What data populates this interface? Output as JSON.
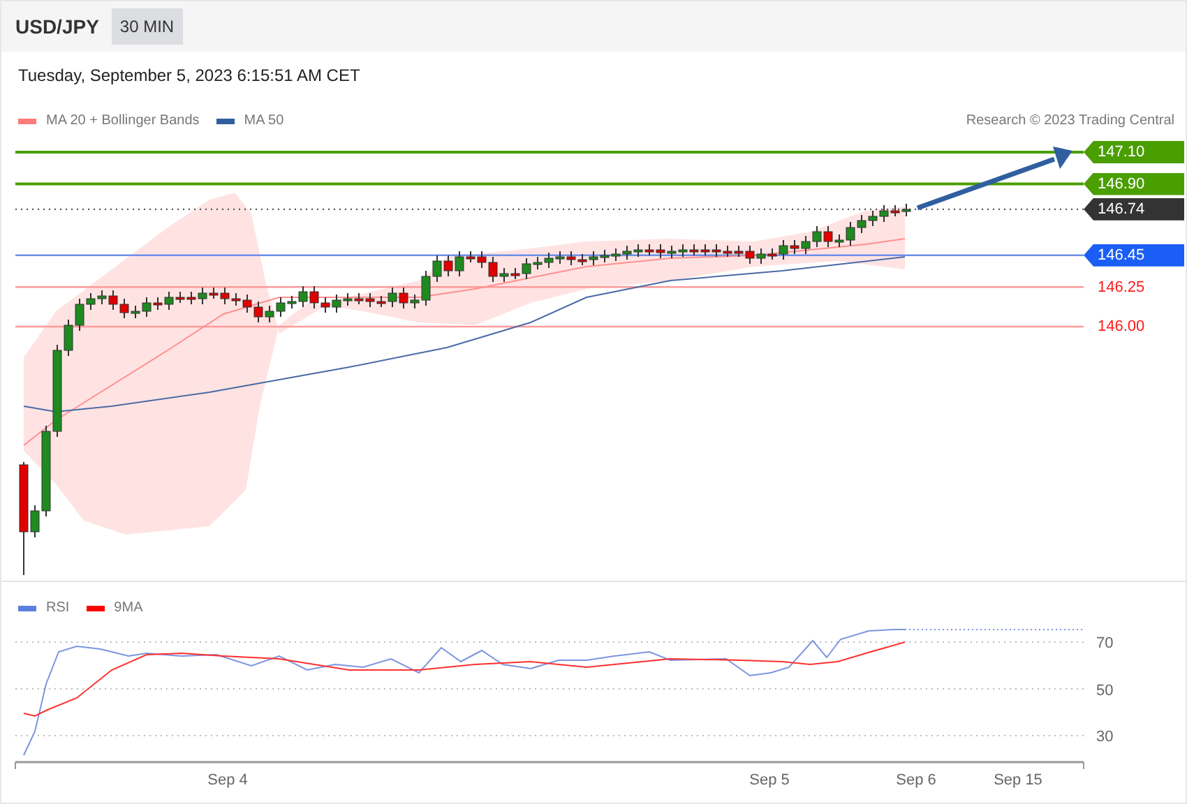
{
  "header": {
    "symbol": "USD/JPY",
    "interval": "30 MIN"
  },
  "timestamp": "Tuesday, September 5, 2023 6:15:51 AM CET",
  "legend": [
    {
      "label": "MA 20 + Bollinger Bands",
      "color": "#ff7b7b"
    },
    {
      "label": "MA 50",
      "color": "#2f5f9f"
    }
  ],
  "copyright": "Research © 2023 Trading Central",
  "levels": [
    {
      "value": "147.10",
      "kind": "target"
    },
    {
      "value": "146.90",
      "kind": "target"
    },
    {
      "value": "146.74",
      "kind": "last"
    },
    {
      "value": "146.45",
      "kind": "pivot"
    },
    {
      "value": "146.25",
      "kind": "support"
    },
    {
      "value": "146.00",
      "kind": "support"
    }
  ],
  "rsi": {
    "legend": [
      {
        "label": "RSI",
        "color": "#5b7fe0"
      },
      {
        "label": "9MA",
        "color": "#ff0000"
      }
    ],
    "ticks": [
      "70",
      "50",
      "30"
    ]
  },
  "x_labels": [
    "Sep 4",
    "Sep 5",
    "Sep 6",
    "Sep 15"
  ]
}
